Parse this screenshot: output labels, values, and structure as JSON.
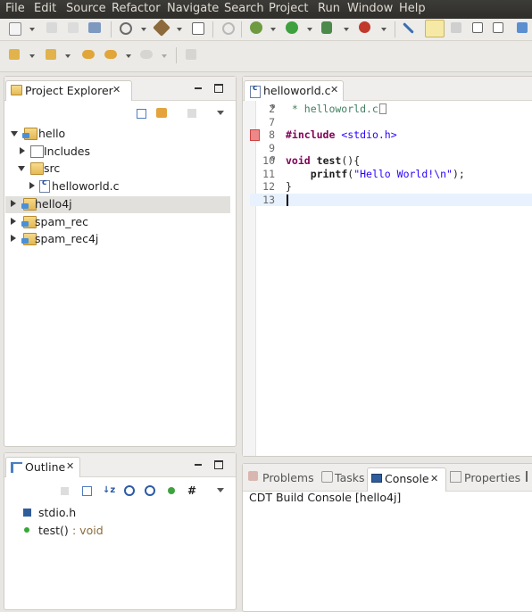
{
  "menu": [
    "File",
    "Edit",
    "Source",
    "Refactor",
    "Navigate",
    "Search",
    "Project",
    "Run",
    "Window",
    "Help"
  ],
  "project_explorer": {
    "title": "Project Explorer",
    "items": [
      {
        "label": "hello",
        "icon": "c-project-icon",
        "expanded": true,
        "level": 0
      },
      {
        "label": "Includes",
        "icon": "includes-icon",
        "expanded": false,
        "level": 1
      },
      {
        "label": "src",
        "icon": "source-folder-icon",
        "expanded": true,
        "level": 1
      },
      {
        "label": "helloworld.c",
        "icon": "c-file-icon",
        "expanded": false,
        "level": 2
      },
      {
        "label": "hello4j",
        "icon": "java-project-icon",
        "expanded": false,
        "level": 0,
        "selected": true
      },
      {
        "label": "spam_rec",
        "icon": "c-project-icon",
        "expanded": false,
        "level": 0
      },
      {
        "label": "spam_rec4j",
        "icon": "java-project-icon",
        "expanded": false,
        "level": 0
      }
    ]
  },
  "outline": {
    "title": "Outline",
    "items": [
      {
        "label": "stdio.h",
        "suffix": "",
        "icon": "include-icon"
      },
      {
        "label": "test()",
        "suffix": " : void",
        "icon": "function-icon"
      }
    ]
  },
  "editor": {
    "tab_title": "helloworld.c",
    "lines": [
      {
        "num": "2",
        "fold": "⊕",
        "text": " * helloworld.c",
        "kind": "comment"
      },
      {
        "num": "7",
        "fold": "",
        "text": "",
        "kind": "plain"
      },
      {
        "num": "8",
        "fold": "",
        "text": "#include <stdio.h>",
        "kind": "include"
      },
      {
        "num": "9",
        "fold": "",
        "text": "",
        "kind": "plain"
      },
      {
        "num": "10",
        "fold": "⊖",
        "text": "void test(){",
        "kind": "func"
      },
      {
        "num": "11",
        "fold": "",
        "text": "    printf(\"Hello World!\\n\");",
        "kind": "printf"
      },
      {
        "num": "12",
        "fold": "",
        "text": "}",
        "kind": "plain"
      },
      {
        "num": "13",
        "fold": "",
        "text": "",
        "kind": "current"
      }
    ]
  },
  "bottom_panel": {
    "tabs": [
      "Problems",
      "Tasks",
      "Console",
      "Properties"
    ],
    "active_tab": "Console",
    "console_title": "CDT Build Console [hello4j]"
  },
  "colors": {
    "menubar": "#3c3b37",
    "keyword": "#7f0055",
    "string": "#2a00ff",
    "comment": "#3f7f5f",
    "selection": "#e2e0dc",
    "current_line": "#e8f2fe"
  }
}
